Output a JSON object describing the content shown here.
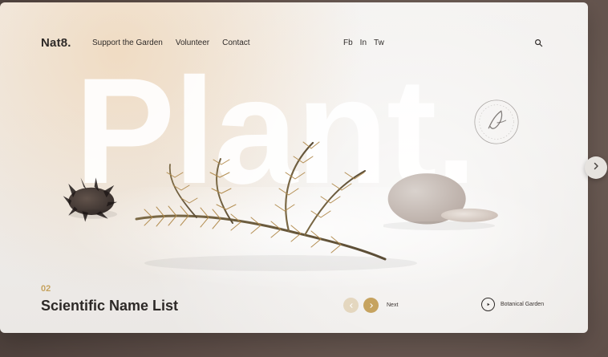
{
  "brand": {
    "name": "Nat8."
  },
  "nav": {
    "items": [
      {
        "label": "Support the Garden"
      },
      {
        "label": "Volunteer"
      },
      {
        "label": "Contact"
      }
    ]
  },
  "social": {
    "items": [
      {
        "label": "Fb"
      },
      {
        "label": "In"
      },
      {
        "label": "Tw"
      }
    ]
  },
  "hero": {
    "big_word": "Plant."
  },
  "slide": {
    "index": "02",
    "title": "Scientific Name List"
  },
  "controls": {
    "next_label": "Next",
    "play_label": "Botanical Garden"
  },
  "icons": {
    "search": "search-icon",
    "prev": "chevron-left-icon",
    "next": "chevron-right-icon",
    "play": "play-icon",
    "side_next": "chevron-right-icon"
  },
  "colors": {
    "accent_gold": "#c6a35f",
    "text_dark": "#2e2a28",
    "bg_frame": "#6b5b54"
  }
}
